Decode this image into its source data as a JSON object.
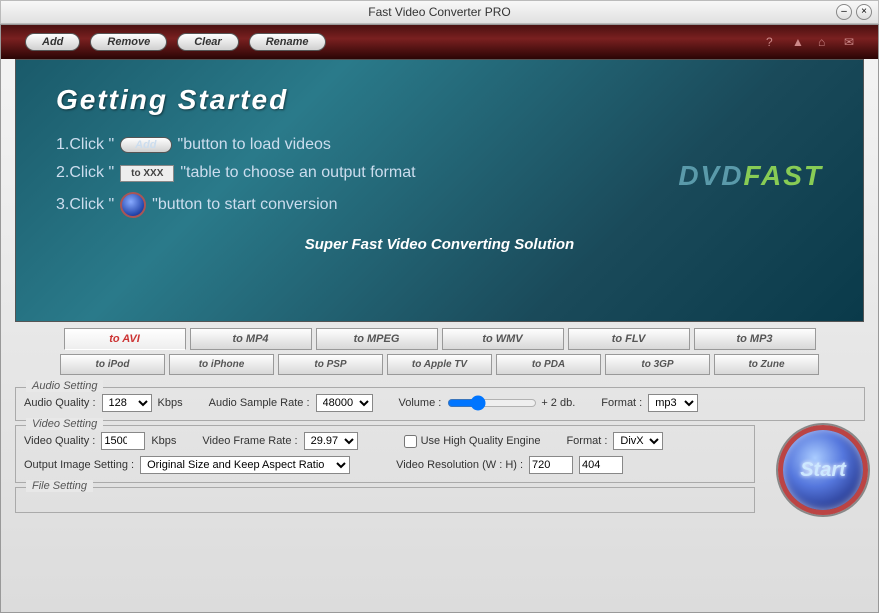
{
  "window": {
    "title": "Fast Video Converter PRO"
  },
  "toolbar": {
    "add": "Add",
    "remove": "Remove",
    "clear": "Clear",
    "rename": "Rename"
  },
  "panel": {
    "heading": "Getting   Started",
    "step1_pre": "1.Click \"",
    "step1_btn": "Add",
    "step1_post": "\"button to load videos",
    "step2_pre": "2.Click \"",
    "step2_btn": "to XXX",
    "step2_post": "\"table to choose an output format",
    "step3_pre": "3.Click \"",
    "step3_post": "\"button to start conversion",
    "tagline": "Super Fast Video Converting Solution",
    "brand1": "DVD",
    "brand2": "FAST"
  },
  "tabs": {
    "row1": [
      "to AVI",
      "to MP4",
      "to MPEG",
      "to WMV",
      "to FLV",
      "to MP3"
    ],
    "row2": [
      "to iPod",
      "to iPhone",
      "to PSP",
      "to Apple TV",
      "to PDA",
      "to 3GP",
      "to Zune"
    ],
    "active": "to AVI"
  },
  "audio": {
    "legend": "Audio Setting",
    "quality_label": "Audio Quality :",
    "quality_value": "128",
    "kbps": "Kbps",
    "sample_label": "Audio Sample Rate :",
    "sample_value": "48000",
    "volume_label": "Volume :",
    "volume_value": "+ 2 db.",
    "format_label": "Format :",
    "format_value": "mp3"
  },
  "video": {
    "legend": "Video Setting",
    "quality_label": "Video Quality :",
    "quality_value": "1500",
    "kbps": "Kbps",
    "frame_label": "Video Frame Rate :",
    "frame_value": "29.97",
    "hq_label": "Use High Quality Engine",
    "format_label": "Format :",
    "format_value": "DivX",
    "output_label": "Output Image Setting :",
    "output_value": "Original Size and Keep Aspect Ratio",
    "res_label": "Video Resolution (W : H) :",
    "res_w": "720",
    "res_h": "404"
  },
  "file": {
    "legend": "File Setting"
  },
  "start": "Start"
}
